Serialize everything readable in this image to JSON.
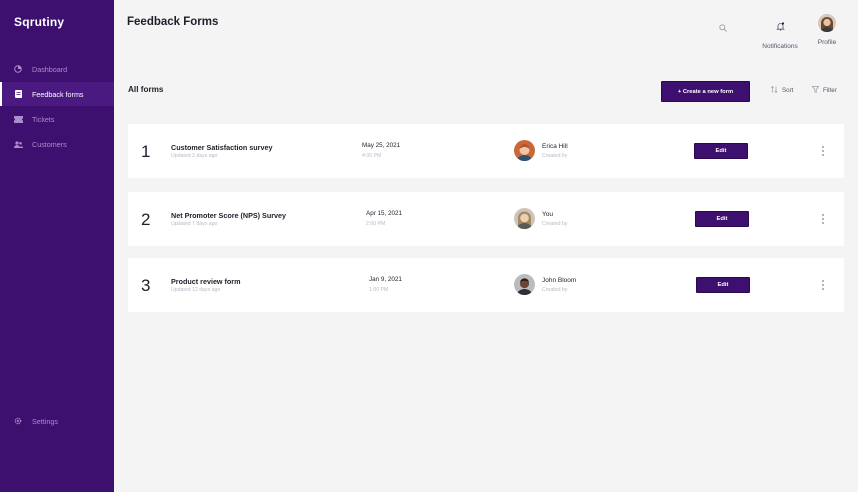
{
  "app": {
    "brand": "Sqrutiny"
  },
  "sidebar": {
    "items": [
      {
        "label": "Dashboard",
        "icon": "dashboard-icon",
        "active": false
      },
      {
        "label": "Feedback forms",
        "icon": "form-icon",
        "active": true
      },
      {
        "label": "Tickets",
        "icon": "ticket-icon",
        "active": false
      },
      {
        "label": "Customers",
        "icon": "customers-icon",
        "active": false
      }
    ],
    "settings_label": "Settings"
  },
  "header": {
    "title": "Feedback Forms",
    "notifications_label": "Notifications",
    "profile_label": "Profile"
  },
  "main": {
    "section_title": "All forms",
    "create_label": "+ Create a new form",
    "sort_label": "Sort",
    "filter_label": "Filter",
    "forms": [
      {
        "num": "1",
        "name": "Customer Satisfaction survey",
        "updated": "Updated 2 days ago",
        "date": "May 25, 2021",
        "time": "4:00 PM",
        "person": "Erica Hill",
        "created_by": "Created by",
        "edit_label": "Edit"
      },
      {
        "num": "2",
        "name": "Net Promoter Score (NPS) Survey",
        "updated": "Updated 7 days ago",
        "date": "Apr 15, 2021",
        "time": "2:00 PM",
        "person": "You",
        "created_by": "Created by",
        "edit_label": "Edit"
      },
      {
        "num": "3",
        "name": "Product review form",
        "updated": "Updated 12 days ago",
        "date": "Jan 9, 2021",
        "time": "1:00 PM",
        "person": "John Bloom",
        "created_by": "Created by",
        "edit_label": "Edit"
      }
    ]
  },
  "colors": {
    "sidebar": "#3d0f6f",
    "accent": "#3d0f6f",
    "background": "#f4f4f4"
  }
}
